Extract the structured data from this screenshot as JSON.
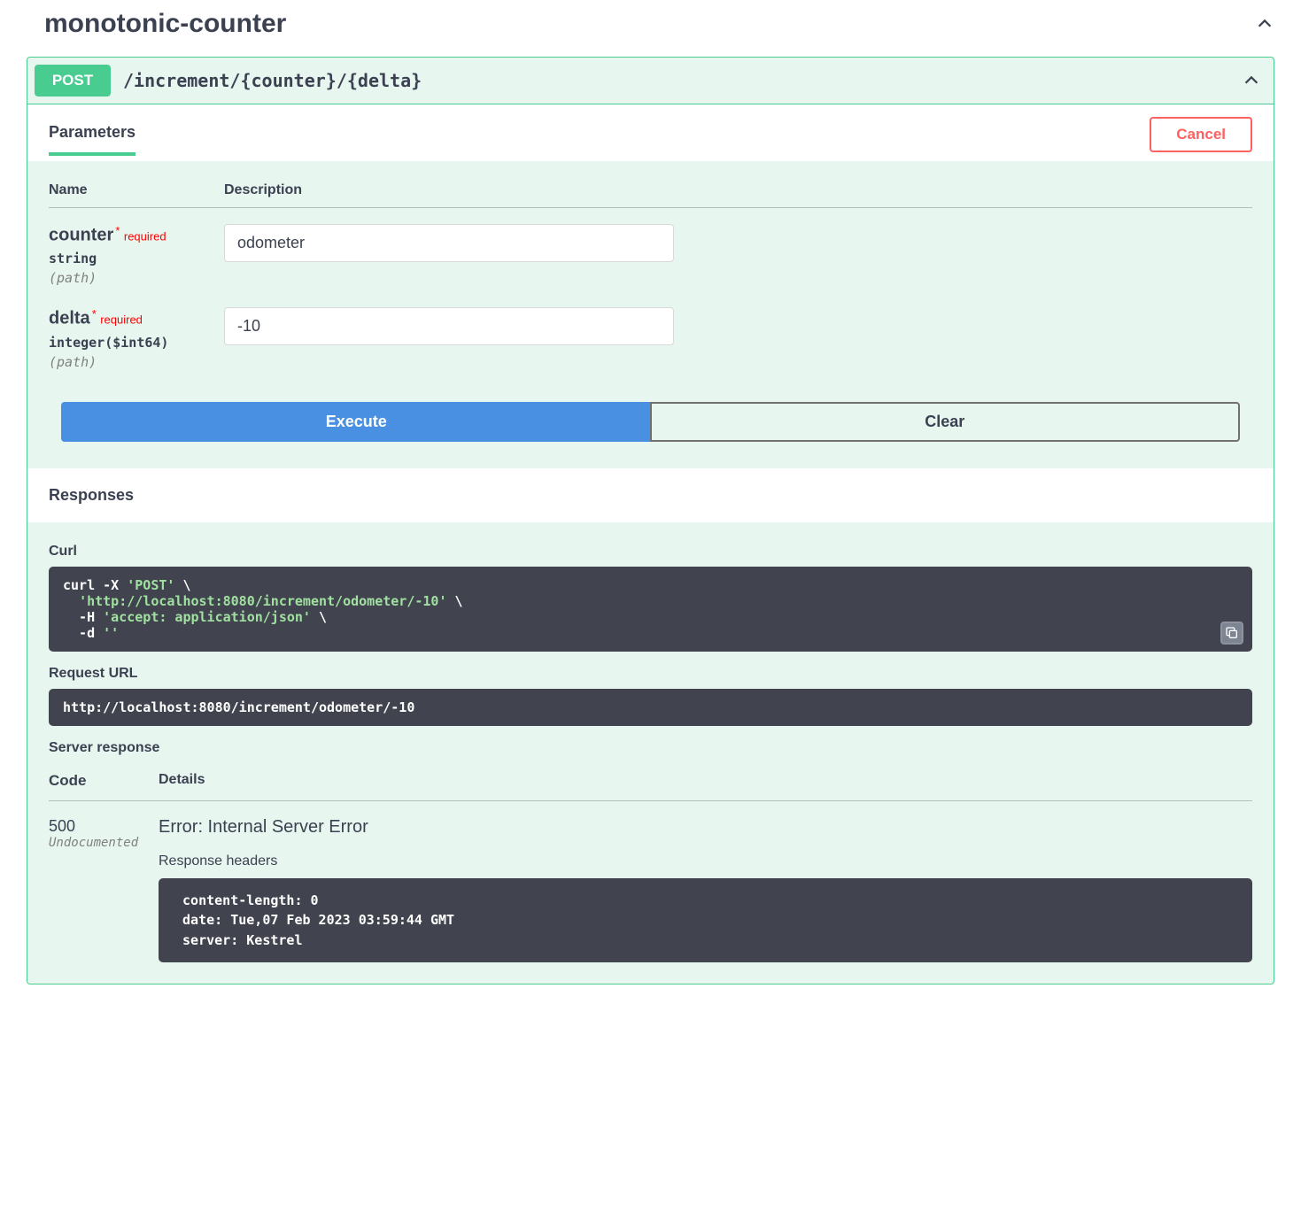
{
  "section": {
    "title": "monotonic-counter"
  },
  "op": {
    "method": "POST",
    "path": "/increment/{counter}/{delta}"
  },
  "tabs": {
    "parameters": "Parameters",
    "cancel": "Cancel"
  },
  "paramHeaders": {
    "name": "Name",
    "description": "Description"
  },
  "params": [
    {
      "name": "counter",
      "required": "required",
      "type": "string",
      "in": "(path)",
      "value": "odometer",
      "placeholder": "counter"
    },
    {
      "name": "delta",
      "required": "required",
      "type": "integer($int64)",
      "in": "(path)",
      "value": "-10",
      "placeholder": "delta"
    }
  ],
  "buttons": {
    "execute": "Execute",
    "clear": "Clear"
  },
  "responsesLabel": "Responses",
  "curl": {
    "label": "Curl",
    "line1a": "curl -X ",
    "line1b": "'POST'",
    "line1c": " \\",
    "line2a": "  ",
    "line2b": "'http://localhost:8080/increment/odometer/-10'",
    "line2c": " \\",
    "line3a": "  -H ",
    "line3b": "'accept: application/json'",
    "line3c": " \\",
    "line4a": "  -d ",
    "line4b": "''"
  },
  "requestUrl": {
    "label": "Request URL",
    "value": "http://localhost:8080/increment/odometer/-10"
  },
  "serverResponseLabel": "Server response",
  "respTable": {
    "code": "Code",
    "details": "Details"
  },
  "response": {
    "code": "500",
    "undocumented": "Undocumented",
    "error": "Error: Internal Server Error",
    "headersLabel": "Response headers",
    "headers": " content-length: 0 \n date: Tue,07 Feb 2023 03:59:44 GMT \n server: Kestrel "
  }
}
